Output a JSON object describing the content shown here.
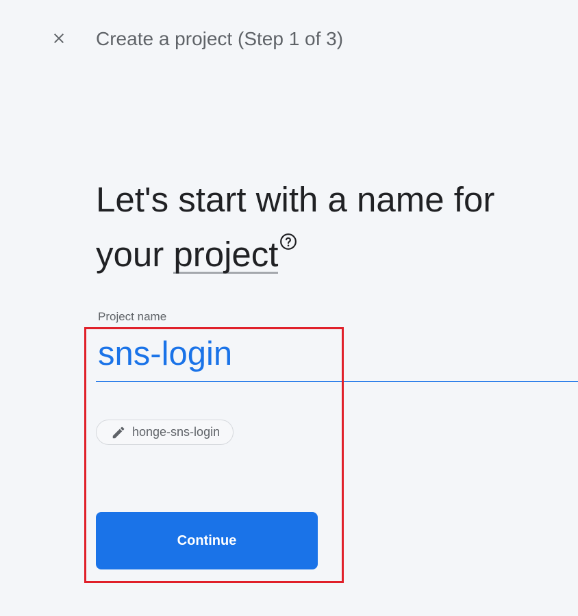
{
  "header": {
    "title": "Create a project (Step 1 of 3)",
    "close_icon": "close-icon"
  },
  "headline": {
    "line1": "Let's start with a name for",
    "line2_prefix": "your ",
    "line2_link": "project",
    "help_icon": "help-circle-icon"
  },
  "project_name": {
    "label": "Project name",
    "value": "sns-login"
  },
  "project_id_chip": {
    "icon": "pencil-icon",
    "text": "honge-sns-login"
  },
  "continue_button": {
    "label": "Continue"
  },
  "colors": {
    "accent": "#1a73e8",
    "highlight": "#e0202a",
    "background": "#f4f6f9"
  }
}
